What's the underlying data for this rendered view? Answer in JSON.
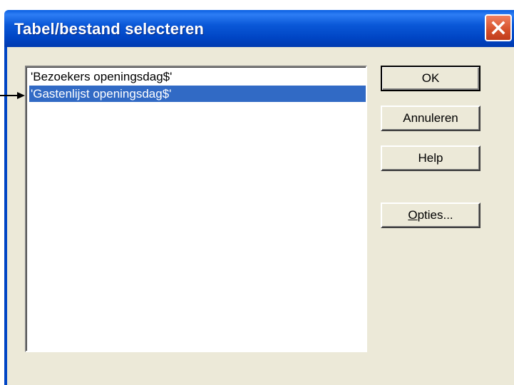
{
  "window": {
    "title": "Tabel/bestand selecteren"
  },
  "list": {
    "items": [
      {
        "label": "'Bezoekers openingsdag$'",
        "selected": false
      },
      {
        "label": "'Gastenlijst openingsdag$'",
        "selected": true
      }
    ]
  },
  "buttons": {
    "ok": "OK",
    "cancel": "Annuleren",
    "help": "Help",
    "options_first": "O",
    "options_rest": "pties..."
  },
  "colors": {
    "titlebar": "#0045c4",
    "selection": "#316ac5",
    "dialog_bg": "#ece9d8",
    "close": "#d5502a"
  },
  "icons": {
    "close": "close-icon",
    "pointer": "arrow-right-icon"
  }
}
